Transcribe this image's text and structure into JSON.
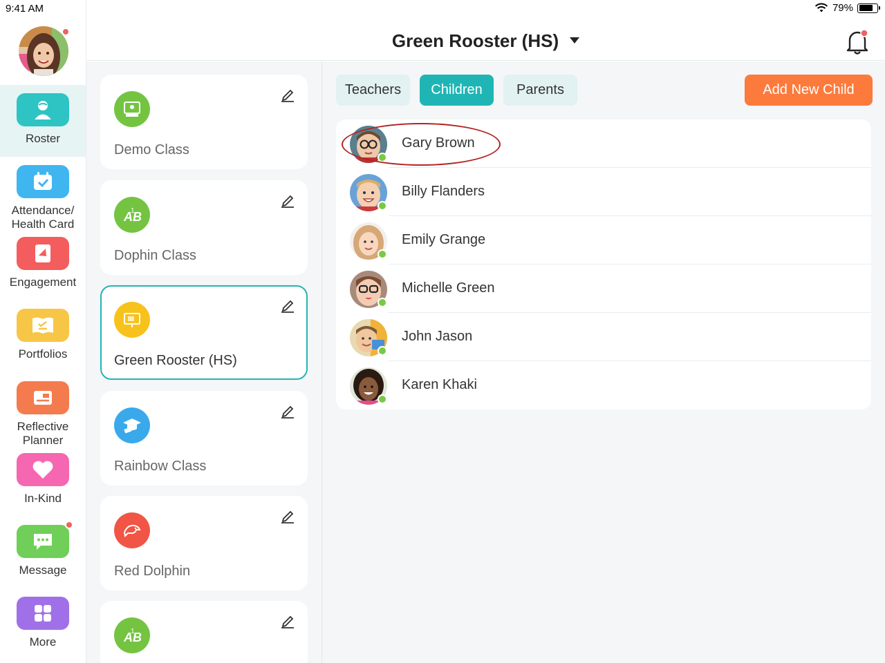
{
  "status_bar": {
    "time": "9:41 AM",
    "battery": "79%",
    "battery_level": 0.79
  },
  "header": {
    "title": "Green Rooster (HS)",
    "notification_icon": "bell-icon"
  },
  "sidebar": {
    "items": [
      {
        "label": "Roster",
        "icon": "roster-icon",
        "color": "#2ec4c4",
        "active": true
      },
      {
        "label": "Attendance/\nHealth Card",
        "icon": "calendar-check-icon",
        "color": "#3fb6f0"
      },
      {
        "label": "Engagement",
        "icon": "engagement-icon",
        "color": "#f45d5d"
      },
      {
        "label": "Portfolios",
        "icon": "portfolio-icon",
        "color": "#f7c647"
      },
      {
        "label": "Reflective\nPlanner",
        "icon": "planner-icon",
        "color": "#f47b4e"
      },
      {
        "label": "In-Kind",
        "icon": "heart-icon",
        "color": "#f567b0"
      },
      {
        "label": "Message",
        "icon": "message-icon",
        "color": "#6fcf58"
      },
      {
        "label": "More",
        "icon": "grid-icon",
        "color": "#a070e8"
      }
    ]
  },
  "classes": [
    {
      "name": "Demo Class",
      "icon": "demo-class-icon",
      "color": "#74c442"
    },
    {
      "name": "Dophin Class",
      "icon": "abc-icon",
      "color": "#74c442"
    },
    {
      "name": "Green Rooster (HS)",
      "icon": "board-icon",
      "color": "#f7c21b",
      "active": true
    },
    {
      "name": "Rainbow Class",
      "icon": "graduation-icon",
      "color": "#3aa9ec"
    },
    {
      "name": "Red Dolphin",
      "icon": "dolphin-icon",
      "color": "#f05545"
    },
    {
      "name": "",
      "icon": "abc-icon",
      "color": "#74c442"
    }
  ],
  "tabs": {
    "teachers": "Teachers",
    "children": "Children",
    "parents": "Parents",
    "active": "Children"
  },
  "add_button": "Add New Child",
  "children": [
    {
      "name": "Gary Brown",
      "highlighted": true
    },
    {
      "name": "Billy Flanders"
    },
    {
      "name": "Emily Grange"
    },
    {
      "name": "Michelle Green"
    },
    {
      "name": "John Jason"
    },
    {
      "name": "Karen Khaki"
    }
  ],
  "colors": {
    "accent": "#20b5b5",
    "add_button": "#fc7a3c",
    "notification_dot": "#f0625f",
    "online": "#7ac943"
  }
}
